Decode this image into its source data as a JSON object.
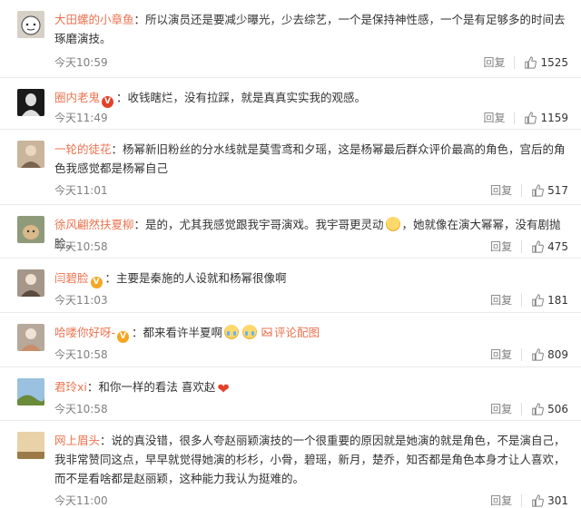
{
  "comments": [
    {
      "username": "大田螺的小章鱼",
      "badge": "",
      "text": "所以演员还是要减少曝光，少去综艺，一个是保持神性感，一个是有足够多的时间去琢磨演技。",
      "time": "今天10:59",
      "reply": "回复",
      "likes": "1525",
      "avatar_icon": "avatar-cartoon"
    },
    {
      "username": "圈内老鬼",
      "badge": "V",
      "text": "收钱瞎烂，没有拉踩，就是真真实实我的观感。",
      "time": "今天11:49",
      "reply": "回复",
      "likes": "1159",
      "avatar_icon": "avatar-dark"
    },
    {
      "username": "一轮的徒花",
      "badge": "",
      "text": "杨幂新旧粉丝的分水线就是莫雪鸢和夕瑶，这是杨幂最后群众评价最高的角色，宫后的角色我感觉都是杨幂自己",
      "time": "今天11:01",
      "reply": "回复",
      "likes": "517",
      "avatar_icon": "avatar-person"
    },
    {
      "username": "徐风翩然扶夏柳",
      "badge": "",
      "text_a": "是的，尤其我感觉跟我宇哥演戏。我宇哥更灵动",
      "text_b": "，她就像在演大幂幂，没有剧抛脸。",
      "time": "今天10:58",
      "reply": "回复",
      "likes": "475",
      "avatar_icon": "avatar-animal"
    },
    {
      "username": "闫碧脸",
      "badge": "V",
      "text": "主要是秦施的人设就和杨幂很像啊",
      "time": "今天11:03",
      "reply": "回复",
      "likes": "181",
      "avatar_icon": "avatar-person"
    },
    {
      "username": "哈喽你好呀-",
      "badge": "V",
      "text": "都来看许半夏啊",
      "link": "评论配图",
      "time": "今天10:58",
      "reply": "回复",
      "likes": "809",
      "avatar_icon": "avatar-person"
    },
    {
      "username": "君玲xi",
      "badge": "",
      "text": "和你一样的看法 喜欢赵",
      "time": "今天10:58",
      "reply": "回复",
      "likes": "506",
      "avatar_icon": "avatar-landscape"
    },
    {
      "username": "网上眉头",
      "badge": "",
      "text": "说的真没错，很多人夸赵丽颖演技的一个很重要的原因就是她演的就是角色，不是演自己，我非常赞同这点，早早就觉得她演的杉杉，小骨，碧瑶，新月，楚乔，知否都是角色本身才让人喜欢，而不是看啥都是赵丽颖，这种能力我认为挺难的。",
      "time": "今天11:00",
      "reply": "回复",
      "likes": "301",
      "avatar_icon": "avatar-landscape"
    }
  ],
  "colors": {
    "username": "#eb7350",
    "meta": "#808080",
    "text": "#333333"
  }
}
